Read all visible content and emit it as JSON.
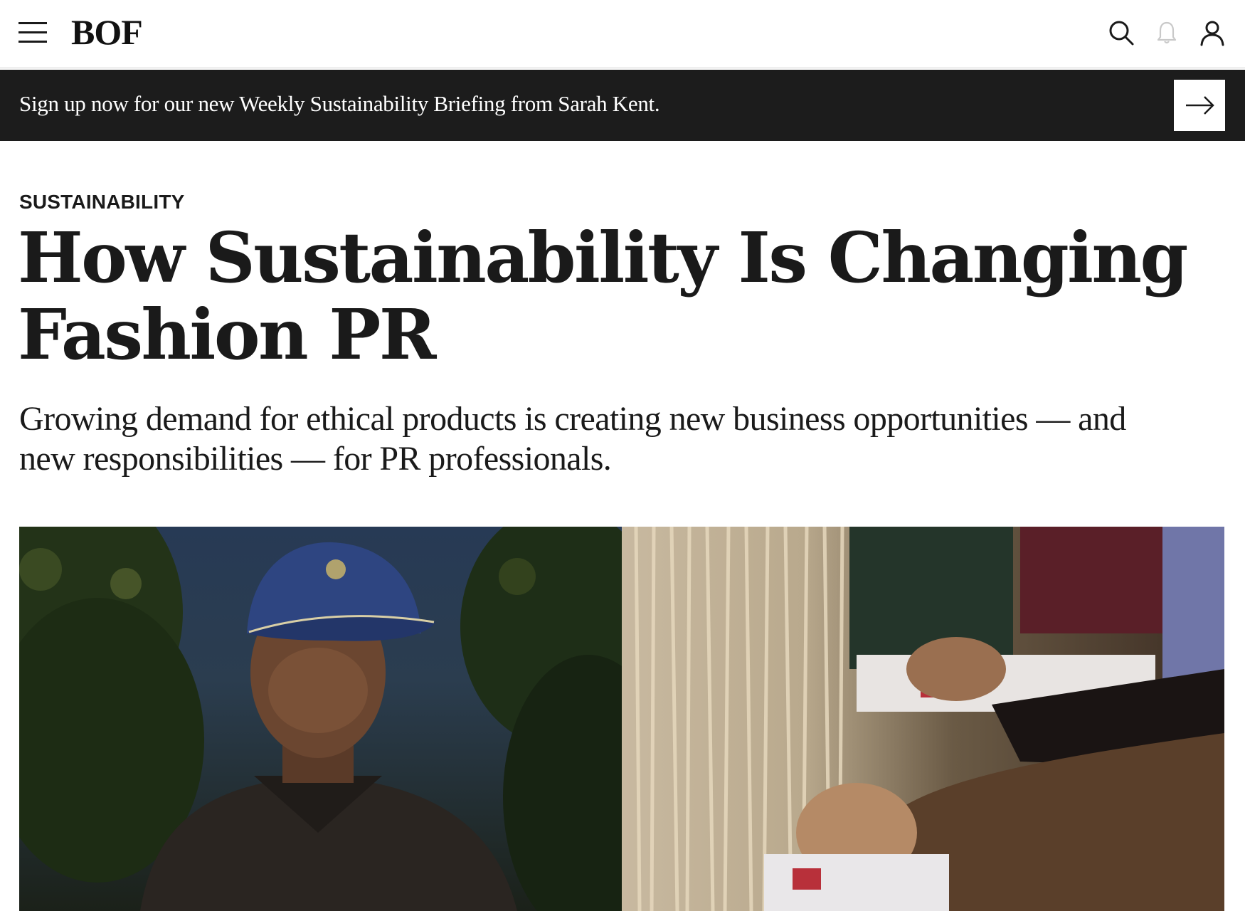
{
  "header": {
    "logo_text": "BOF",
    "icons": [
      "menu-icon",
      "search-icon",
      "bell-icon",
      "user-icon"
    ]
  },
  "banner": {
    "text": "Sign up now for our new Weekly Sustainability Briefing from Sarah Kent.",
    "cta_icon": "arrow-right-icon"
  },
  "article": {
    "category": "SUSTAINABILITY",
    "headline_line1": "How Sustainability Is Changing",
    "headline_line2": "Fashion PR",
    "dek_line1": "Growing demand for ethical products is creating new business opportunities — and",
    "dek_line2": "new responsibilities — for PR professionals."
  },
  "colors": {
    "banner_bg": "#1c1c1c",
    "text": "#1a1a1a",
    "background": "#ffffff"
  }
}
